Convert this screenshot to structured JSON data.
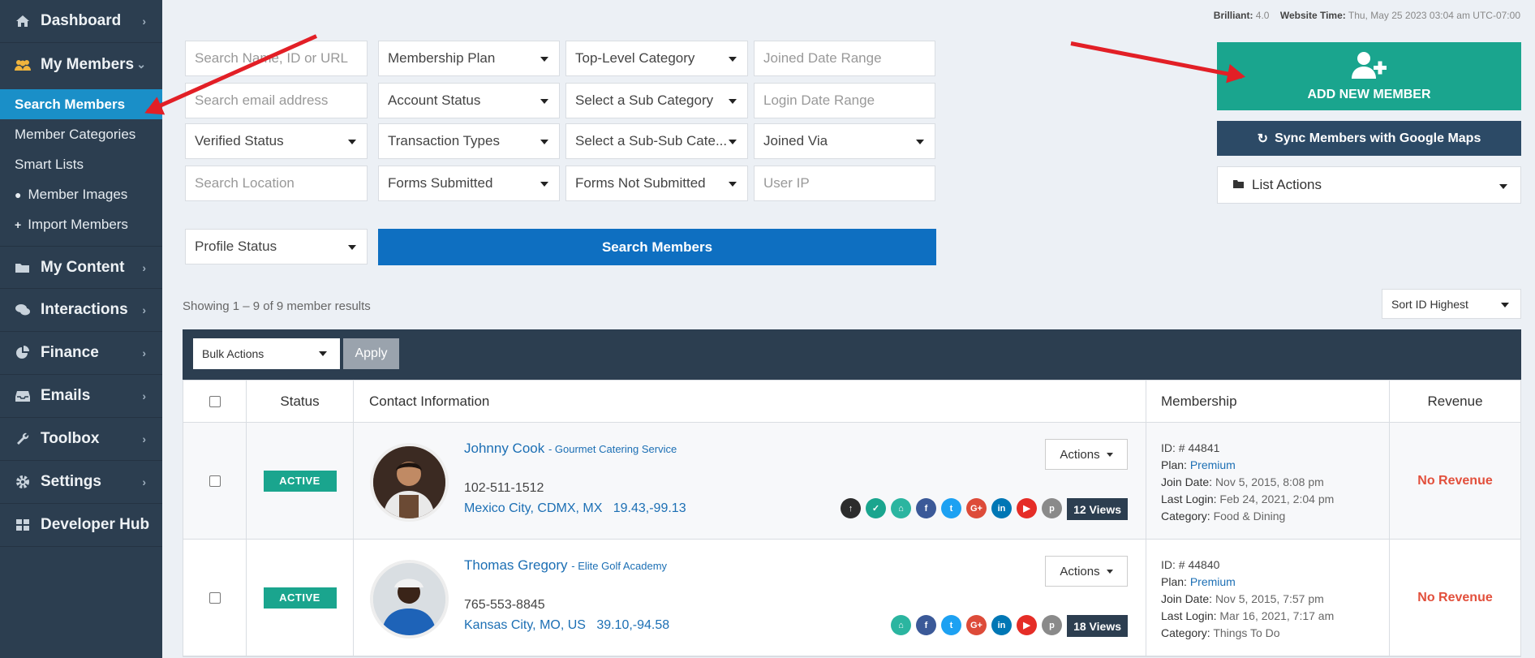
{
  "sidebar": {
    "items": [
      {
        "label": "Dashboard",
        "icon": "home-icon"
      },
      {
        "label": "My Members",
        "icon": "users-icon"
      },
      {
        "label": "My Content",
        "icon": "folder-icon"
      },
      {
        "label": "Interactions",
        "icon": "chat-icon"
      },
      {
        "label": "Finance",
        "icon": "pie-chart-icon"
      },
      {
        "label": "Emails",
        "icon": "inbox-icon"
      },
      {
        "label": "Toolbox",
        "icon": "wrench-icon"
      },
      {
        "label": "Settings",
        "icon": "gear-icon"
      },
      {
        "label": "Developer Hub",
        "icon": "grid-icon"
      }
    ],
    "sub": [
      "Search Members",
      "Member Categories",
      "Smart Lists",
      "Member Images",
      "Import Members"
    ]
  },
  "top": {
    "brand": "Brilliant:",
    "version": "4.0",
    "time_label": "Website Time:",
    "time_value": "Thu, May 25 2023 03:04 am UTC-07:00"
  },
  "filters": {
    "search_name": "Search Name, ID or URL",
    "membership_plan": "Membership Plan",
    "top_category": "Top-Level Category",
    "joined_range": "Joined Date Range",
    "search_email": "Search email address",
    "account_status": "Account Status",
    "sub_category": "Select a Sub Category",
    "login_range": "Login Date Range",
    "verified": "Verified Status",
    "transaction_types": "Transaction Types",
    "subsub": "Select a Sub-Sub Cate...",
    "joined_via": "Joined Via",
    "search_location": "Search Location",
    "forms_submitted": "Forms Submitted",
    "forms_not_submitted": "Forms Not Submitted",
    "user_ip": "User IP",
    "profile_status": "Profile Status",
    "search_button": "Search Members"
  },
  "actions": {
    "add_new": "ADD NEW MEMBER",
    "sync": "Sync Members with Google Maps",
    "list_actions": "List Actions"
  },
  "results": {
    "showing": "Showing 1 – 9 of 9 member results",
    "sort": "Sort ID Highest",
    "bulk": "Bulk Actions",
    "apply": "Apply"
  },
  "table": {
    "headers": {
      "status": "Status",
      "contact": "Contact Information",
      "membership": "Membership",
      "revenue": "Revenue"
    },
    "rows": [
      {
        "status": "ACTIVE",
        "name": "Johnny Cook",
        "company": "- Gourmet Catering Service",
        "phone": "102-511-1512",
        "location": "Mexico City, CDMX, MX",
        "coords": "19.43,-99.13",
        "actions": "Actions",
        "views": "12 Views",
        "id": "ID: # 44841",
        "plan_k": "Plan:",
        "plan": "Premium",
        "join_k": "Join Date:",
        "join": "Nov 5, 2015, 8:08 pm",
        "login_k": "Last Login:",
        "login": "Feb 24, 2021, 2:04 pm",
        "cat_k": "Category:",
        "cat": "Food & Dining",
        "revenue": "No Revenue"
      },
      {
        "status": "ACTIVE",
        "name": "Thomas Gregory",
        "company": "- Elite Golf Academy",
        "phone": "765-553-8845",
        "location": "Kansas City, MO, US",
        "coords": "39.10,-94.58",
        "actions": "Actions",
        "views": "18 Views",
        "id": "ID: # 44840",
        "plan_k": "Plan:",
        "plan": "Premium",
        "join_k": "Join Date:",
        "join": "Nov 5, 2015, 7:57 pm",
        "login_k": "Last Login:",
        "login": "Mar 16, 2021, 7:17 am",
        "cat_k": "Category:",
        "cat": "Things To Do",
        "revenue": "No Revenue"
      }
    ]
  },
  "colors": {
    "sidebar": "#2c3e50",
    "active": "#1a8fc8",
    "accent": "#1aa58e",
    "primary": "#0e6fc1",
    "arrow": "#e21f26"
  }
}
